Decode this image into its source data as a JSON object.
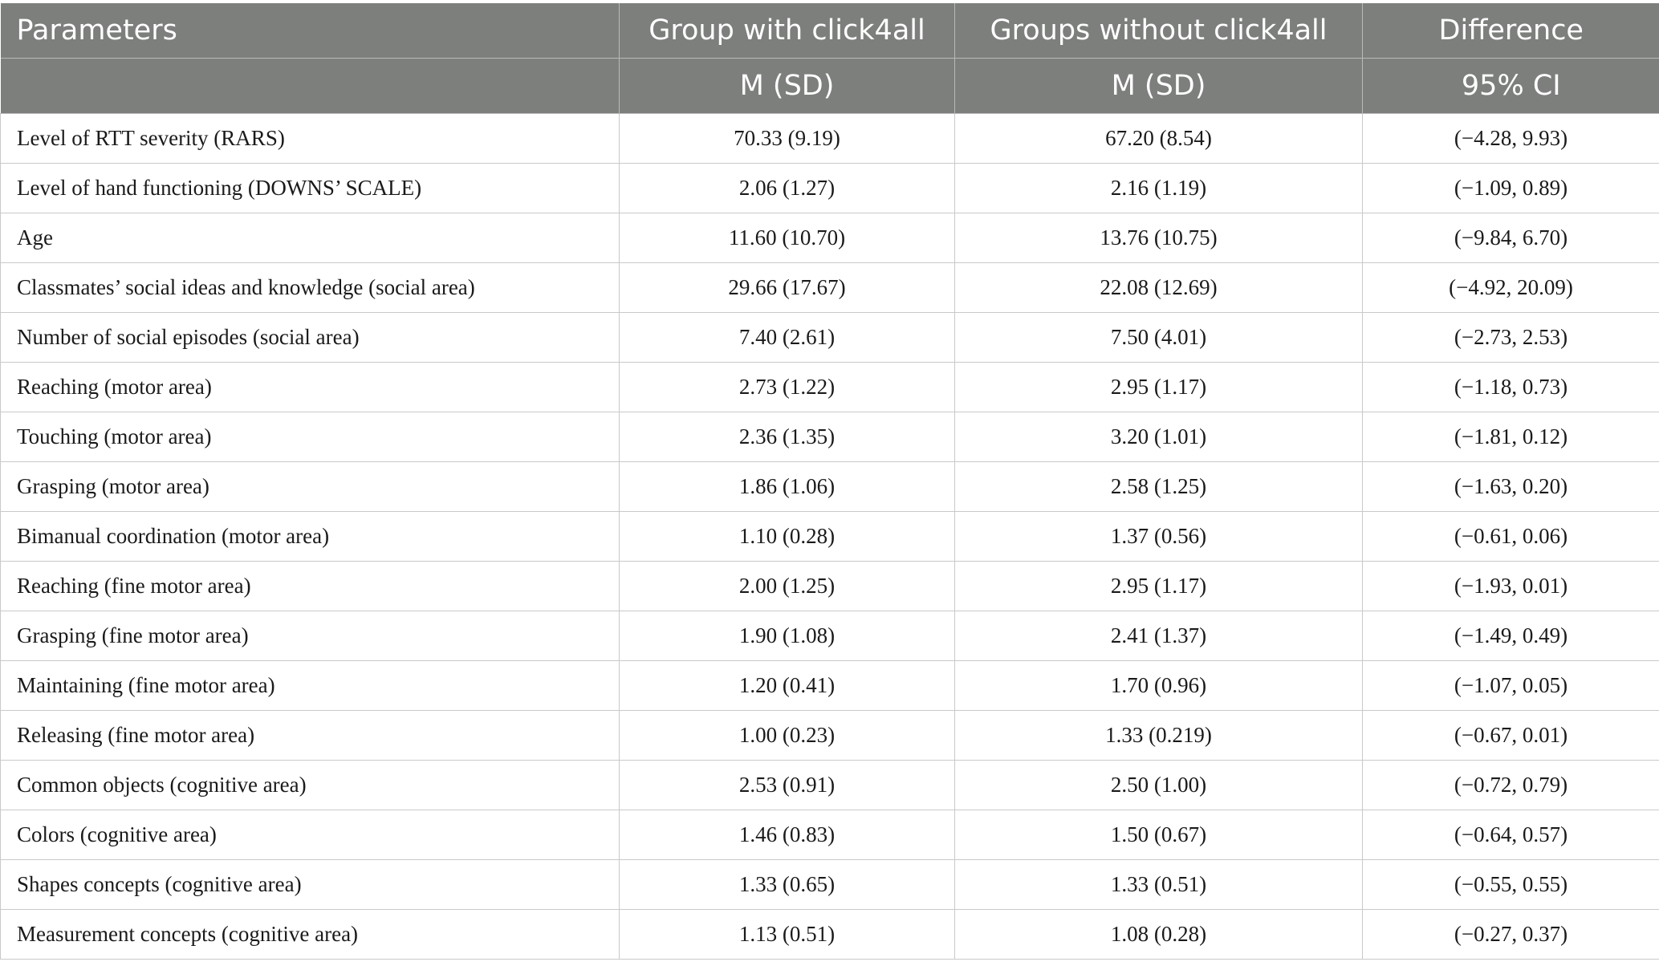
{
  "header": {
    "row1": [
      "Parameters",
      "Group with click4all",
      "Groups without click4all",
      "Difference"
    ],
    "row2": [
      "",
      "M (SD)",
      "M (SD)",
      "95% CI"
    ]
  },
  "rows": [
    {
      "parameter": "Level of RTT severity (RARS)",
      "with": "70.33 (9.19)",
      "without": "67.20 (8.54)",
      "ci": "(−4.28, 9.93)"
    },
    {
      "parameter": "Level of hand functioning (DOWNS’ SCALE)",
      "with": "2.06 (1.27)",
      "without": "2.16 (1.19)",
      "ci": "(−1.09, 0.89)"
    },
    {
      "parameter": "Age",
      "with": "11.60 (10.70)",
      "without": "13.76 (10.75)",
      "ci": "(−9.84, 6.70)"
    },
    {
      "parameter": "Classmates’ social ideas and knowledge (social area)",
      "with": "29.66 (17.67)",
      "without": "22.08 (12.69)",
      "ci": "(−4.92, 20.09)"
    },
    {
      "parameter": "Number of social episodes (social area)",
      "with": "7.40 (2.61)",
      "without": "7.50 (4.01)",
      "ci": "(−2.73, 2.53)"
    },
    {
      "parameter": "Reaching (motor area)",
      "with": "2.73 (1.22)",
      "without": "2.95 (1.17)",
      "ci": "(−1.18, 0.73)"
    },
    {
      "parameter": "Touching (motor area)",
      "with": "2.36 (1.35)",
      "without": "3.20 (1.01)",
      "ci": "(−1.81, 0.12)"
    },
    {
      "parameter": "Grasping (motor area)",
      "with": "1.86 (1.06)",
      "without": "2.58 (1.25)",
      "ci": "(−1.63, 0.20)"
    },
    {
      "parameter": "Bimanual coordination (motor area)",
      "with": "1.10 (0.28)",
      "without": "1.37 (0.56)",
      "ci": "(−0.61, 0.06)"
    },
    {
      "parameter": "Reaching (fine motor area)",
      "with": "2.00 (1.25)",
      "without": "2.95 (1.17)",
      "ci": "(−1.93, 0.01)"
    },
    {
      "parameter": "Grasping (fine motor area)",
      "with": "1.90 (1.08)",
      "without": "2.41 (1.37)",
      "ci": "(−1.49, 0.49)"
    },
    {
      "parameter": "Maintaining (fine motor area)",
      "with": "1.20 (0.41)",
      "without": "1.70 (0.96)",
      "ci": "(−1.07, 0.05)"
    },
    {
      "parameter": "Releasing (fine motor area)",
      "with": "1.00 (0.23)",
      "without": "1.33 (0.219)",
      "ci": "(−0.67, 0.01)"
    },
    {
      "parameter": "Common objects (cognitive area)",
      "with": "2.53 (0.91)",
      "without": "2.50 (1.00)",
      "ci": "(−0.72, 0.79)"
    },
    {
      "parameter": "Colors (cognitive area)",
      "with": "1.46 (0.83)",
      "without": "1.50 (0.67)",
      "ci": "(−0.64, 0.57)"
    },
    {
      "parameter": "Shapes concepts (cognitive area)",
      "with": "1.33 (0.65)",
      "without": "1.33 (0.51)",
      "ci": "(−0.55, 0.55)"
    },
    {
      "parameter": "Measurement concepts (cognitive area)",
      "with": "1.13 (0.51)",
      "without": "1.08 (0.28)",
      "ci": "(−0.27, 0.37)"
    }
  ]
}
